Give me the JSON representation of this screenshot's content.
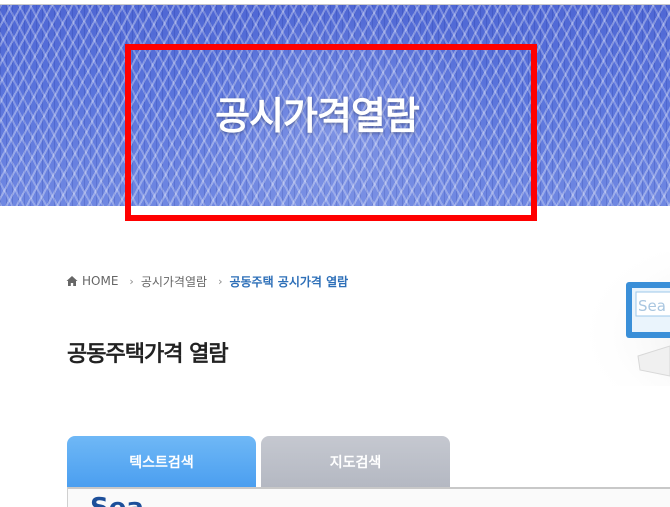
{
  "banner": {
    "title": "공시가격열람"
  },
  "breadcrumb": {
    "home": "HOME",
    "level1": "공시가격열람",
    "current": "공동주택 공시가격 열람"
  },
  "decor": {
    "screen_text": "Sea"
  },
  "page": {
    "title": "공동주택가격 열람"
  },
  "tabs": [
    {
      "label": "텍스트검색",
      "active": true
    },
    {
      "label": "지도검색",
      "active": false
    }
  ],
  "panel": {
    "heading": "Sea"
  },
  "colors": {
    "banner": "#5a74dc",
    "highlight": "#ff0000",
    "breadcrumb_current": "#2d6fb8",
    "tab_active": "#4a9ef0",
    "tab_inactive": "#b4b8c2"
  }
}
